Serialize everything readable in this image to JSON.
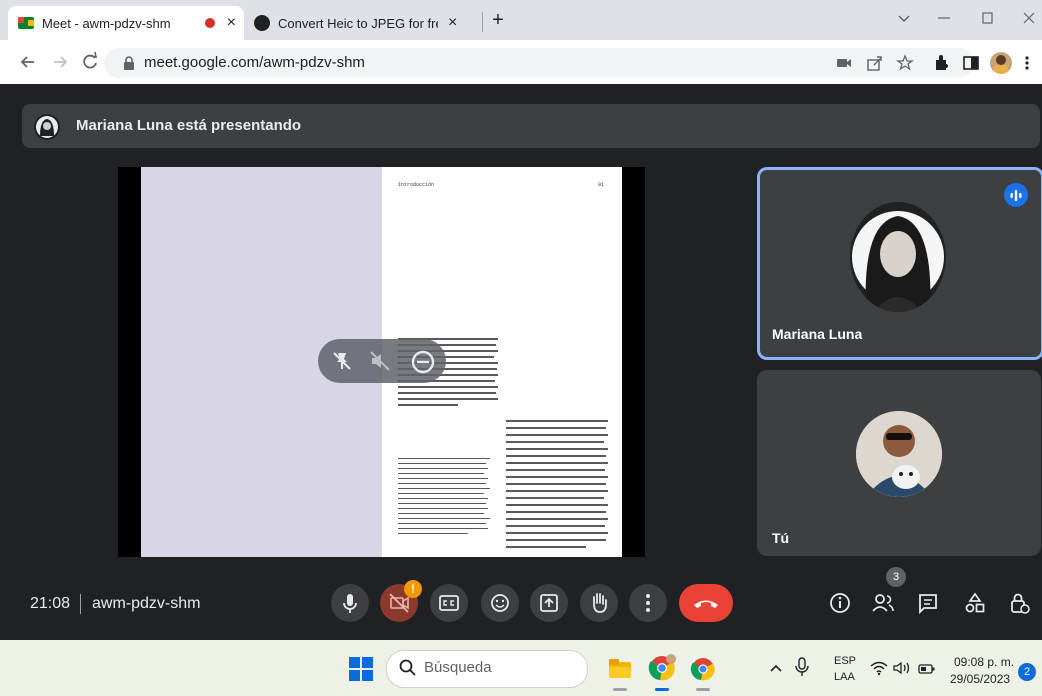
{
  "browser": {
    "tabs": [
      {
        "title": "Meet - awm-pdzv-shm"
      },
      {
        "title": "Convert Heic to JPEG for free | M"
      }
    ],
    "close_glyph": "×",
    "new_tab_glyph": "+",
    "url": "meet.google.com/awm-pdzv-shm"
  },
  "meet": {
    "presenting_text": "Mariana Luna está presentando",
    "slide": {
      "header_left": "Introducción",
      "header_right": "01"
    },
    "participants": [
      {
        "name": "Mariana Luna"
      },
      {
        "name": "Tú"
      }
    ],
    "time": "21:08",
    "meeting_code": "awm-pdzv-shm",
    "people_count": "3",
    "alert_glyph": "!"
  },
  "taskbar": {
    "search_placeholder": "Búsqueda",
    "lang_top": "ESP",
    "lang_bottom": "LAA",
    "clock_time": "09:08 p. m.",
    "clock_date": "29/05/2023",
    "notification_count": "2"
  },
  "colors": {
    "meet_bg": "#202124",
    "hangup_red": "#ea4335",
    "accent_blue": "#8ab4f8",
    "speaking_blue": "#1a73e8"
  }
}
